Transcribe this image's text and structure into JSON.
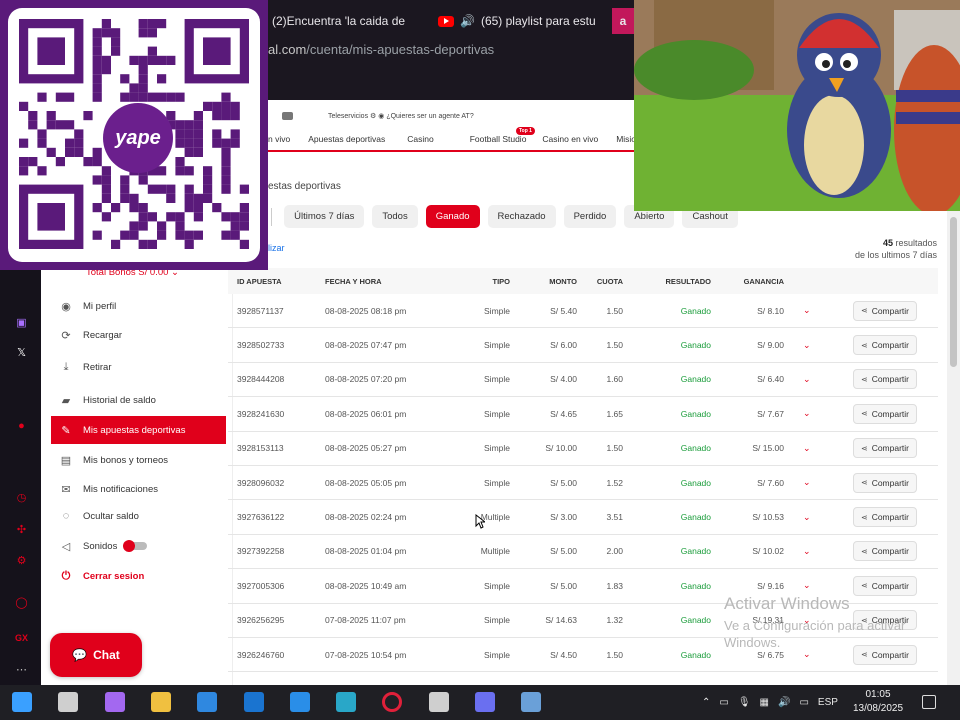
{
  "browser": {
    "tabs": [
      {
        "label": "(2)Encuentra 'la caida de"
      },
      {
        "label": "(65) playlist para estu"
      },
      {
        "label": "a"
      }
    ],
    "address": {
      "host": "al.com",
      "path": "/cuenta/mis-apuestas-deportivas"
    }
  },
  "site": {
    "top_links": {
      "teleservicios": "Teleservicios",
      "question": "¿Quieres ser un agente AT?"
    },
    "nav": [
      {
        "label": "n vivo"
      },
      {
        "label": "Apuestas deportivas"
      },
      {
        "label": "Casino"
      },
      {
        "label": "Football Studio"
      },
      {
        "label": "Casino en vivo"
      },
      {
        "label": "Misio"
      }
    ],
    "top_badge": "Top 1"
  },
  "page": {
    "title": "estas deportivas",
    "filters": {
      "fragment": "r",
      "pills": [
        {
          "label": "Últimos 7 días",
          "active": false
        },
        {
          "label": "Todos",
          "active": false
        },
        {
          "label": "Ganado",
          "active": true
        },
        {
          "label": "Rechazado",
          "active": false
        },
        {
          "label": "Perdido",
          "active": false
        },
        {
          "label": "Abierto",
          "active": false
        },
        {
          "label": "Cashout",
          "active": false
        }
      ]
    },
    "clear_link": "lizar",
    "results": {
      "count": "45",
      "label": " resultados",
      "range": "de los ultimos 7 días"
    }
  },
  "sidebar": {
    "total_bonos": "Total Bonos S/ 0.00",
    "items": [
      {
        "label": "Mi perfil",
        "icon": "user-circle-icon",
        "glyph": "◉"
      },
      {
        "label": "Recargar",
        "icon": "recharge-icon",
        "glyph": "⟳"
      },
      {
        "label": "Retirar",
        "icon": "withdraw-icon",
        "glyph": "⤓"
      },
      {
        "label": "Historial de saldo",
        "icon": "wallet-icon",
        "glyph": "▰"
      },
      {
        "label": "Mis apuestas deportivas",
        "icon": "ticket-icon",
        "glyph": "✎"
      },
      {
        "label": "Mis bonos y torneos",
        "icon": "gift-icon",
        "glyph": "▤"
      },
      {
        "label": "Mis notificaciones",
        "icon": "mail-icon",
        "glyph": "✉"
      },
      {
        "label": "Ocultar saldo",
        "icon": "eye-off-icon",
        "glyph": "◌"
      },
      {
        "label": "Sonidos",
        "icon": "speaker-icon",
        "glyph": "◁"
      },
      {
        "label": "Cerrar sesion",
        "icon": "power-icon",
        "glyph": "⏻"
      }
    ]
  },
  "table": {
    "headers": {
      "id": "ID APUESTA",
      "date": "FECHA Y HORA",
      "tipo": "TIPO",
      "monto": "MONTO",
      "cuota": "CUOTA",
      "resultado": "RESULTADO",
      "ganancia": "GANANCIA"
    },
    "share_label": "Compartir",
    "rows": [
      {
        "id": "3928571137",
        "date": "08-08-2025 08:18 pm",
        "tipo": "Simple",
        "monto": "S/ 5.40",
        "cuota": "1.50",
        "resultado": "Ganado",
        "ganancia": "S/ 8.10"
      },
      {
        "id": "3928502733",
        "date": "08-08-2025 07:47 pm",
        "tipo": "Simple",
        "monto": "S/ 6.00",
        "cuota": "1.50",
        "resultado": "Ganado",
        "ganancia": "S/ 9.00"
      },
      {
        "id": "3928444208",
        "date": "08-08-2025 07:20 pm",
        "tipo": "Simple",
        "monto": "S/ 4.00",
        "cuota": "1.60",
        "resultado": "Ganado",
        "ganancia": "S/ 6.40"
      },
      {
        "id": "3928241630",
        "date": "08-08-2025 06:01 pm",
        "tipo": "Simple",
        "monto": "S/ 4.65",
        "cuota": "1.65",
        "resultado": "Ganado",
        "ganancia": "S/ 7.67"
      },
      {
        "id": "3928153113",
        "date": "08-08-2025 05:27 pm",
        "tipo": "Simple",
        "monto": "S/ 10.00",
        "cuota": "1.50",
        "resultado": "Ganado",
        "ganancia": "S/ 15.00"
      },
      {
        "id": "3928096032",
        "date": "08-08-2025 05:05 pm",
        "tipo": "Simple",
        "monto": "S/ 5.00",
        "cuota": "1.52",
        "resultado": "Ganado",
        "ganancia": "S/ 7.60"
      },
      {
        "id": "3927636122",
        "date": "08-08-2025 02:24 pm",
        "tipo": "Multiple",
        "monto": "S/ 3.00",
        "cuota": "3.51",
        "resultado": "Ganado",
        "ganancia": "S/ 10.53"
      },
      {
        "id": "3927392258",
        "date": "08-08-2025 01:04 pm",
        "tipo": "Multiple",
        "monto": "S/ 5.00",
        "cuota": "2.00",
        "resultado": "Ganado",
        "ganancia": "S/ 10.02"
      },
      {
        "id": "3927005306",
        "date": "08-08-2025 10:49 am",
        "tipo": "Simple",
        "monto": "S/ 5.00",
        "cuota": "1.83",
        "resultado": "Ganado",
        "ganancia": "S/ 9.16"
      },
      {
        "id": "3926256295",
        "date": "07-08-2025 11:07 pm",
        "tipo": "Simple",
        "monto": "S/ 14.63",
        "cuota": "1.32",
        "resultado": "Ganado",
        "ganancia": "S/ 19.31"
      },
      {
        "id": "3926246760",
        "date": "07-08-2025 10:54 pm",
        "tipo": "Simple",
        "monto": "S/ 4.50",
        "cuota": "1.50",
        "resultado": "Ganado",
        "ganancia": "S/ 6.75"
      }
    ]
  },
  "chat": {
    "label": "Chat"
  },
  "qr": {
    "logo_text": "yape"
  },
  "watermark": {
    "title": "Activar Windows",
    "subtitle": "Ve a Configuración para activar Windows."
  },
  "taskbar": {
    "language": "ESP",
    "time": "01:05",
    "date": "13/08/2025",
    "apps": [
      {
        "name": "windows-start-icon",
        "color": "#3aa0ff"
      },
      {
        "name": "task-view-icon",
        "color": "#cfcfcf"
      },
      {
        "name": "copilot-icon",
        "color": "#a368f0"
      },
      {
        "name": "file-explorer-icon",
        "color": "#f0c040"
      },
      {
        "name": "store-icon",
        "color": "#2f88e0"
      },
      {
        "name": "outlook-icon",
        "color": "#1a74d0"
      },
      {
        "name": "vscode-icon",
        "color": "#2a8ee8"
      },
      {
        "name": "edge-icon",
        "color": "#29a7c8"
      },
      {
        "name": "opera-icon",
        "color": "#e0203a"
      },
      {
        "name": "speedometer-icon",
        "color": "#cfcfcf"
      },
      {
        "name": "discord-icon",
        "color": "#6a6ff0"
      },
      {
        "name": "calculator-icon",
        "color": "#6aa0d8"
      }
    ]
  },
  "colors": {
    "brand_red": "#e0001b",
    "win_green": "#1a9c3a"
  }
}
